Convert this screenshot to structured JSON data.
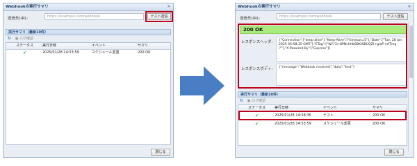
{
  "left": {
    "title": "Webhookの実行サマリ",
    "url_label": "送信先URL:",
    "url_placeholder": "https://example.com/webhook",
    "test_button": "テスト送信",
    "summary_header": "実行サマリ（最新10件）",
    "log_button": "ログ確認",
    "columns": [
      "ステータス",
      "実行日時",
      "イベント",
      "サマリ"
    ],
    "rows": [
      {
        "status": "✔",
        "datetime": "2025/01/28 14:53:59",
        "event": "スケジュール変更",
        "summary": "200 OK"
      }
    ],
    "close_button": "閉じる"
  },
  "right": {
    "title": "Webhookの実行サマリ",
    "url_label": "送信先URL:",
    "url_placeholder": "https://example.com/webhook",
    "test_button": "テスト送信",
    "status_text": "200 OK",
    "resp_header_label": "レスポンスヘッダ:",
    "resp_header_value": "{\"Connection\":[\"keep-alive\"],\"Keep-Alive\":[\"timeout=5\"],\"Date\":[\"Tue, 28 Jan 2025 05:58:35 GMT\"],\"ETag\":[\"W/\\\"2c-8PNchHb68KtSBUQZI+g/aP+sfTmg\\\"\"],\"X-Powered-By\":[\"Express\"]}",
    "resp_body_label": "レスポンスボディ:",
    "resp_body_value": "{\"message\":\"Webhook received\",\"data\":\"test\"}",
    "summary_header": "実行サマリ（最新10件）",
    "log_button": "ログ確認",
    "columns": [
      "ステータス",
      "実行日時",
      "イベント",
      "サマリ"
    ],
    "rows": [
      {
        "status": "✔",
        "datetime": "2025/01/28 14:58:35",
        "event": "テスト",
        "summary": "200 OK"
      },
      {
        "status": "✔",
        "datetime": "2025/01/28 14:53:59",
        "event": "スケジュール変更",
        "summary": "200 OK"
      }
    ],
    "close_button": "閉じる"
  },
  "colors": {
    "highlight": "#c00018",
    "ok_green": "#a9ec7d",
    "arrow": "#4a7ec4"
  },
  "icons": {
    "close": "close-icon",
    "reload": "reload-icon",
    "check": "check-icon",
    "arrow": "right-arrow-icon"
  }
}
